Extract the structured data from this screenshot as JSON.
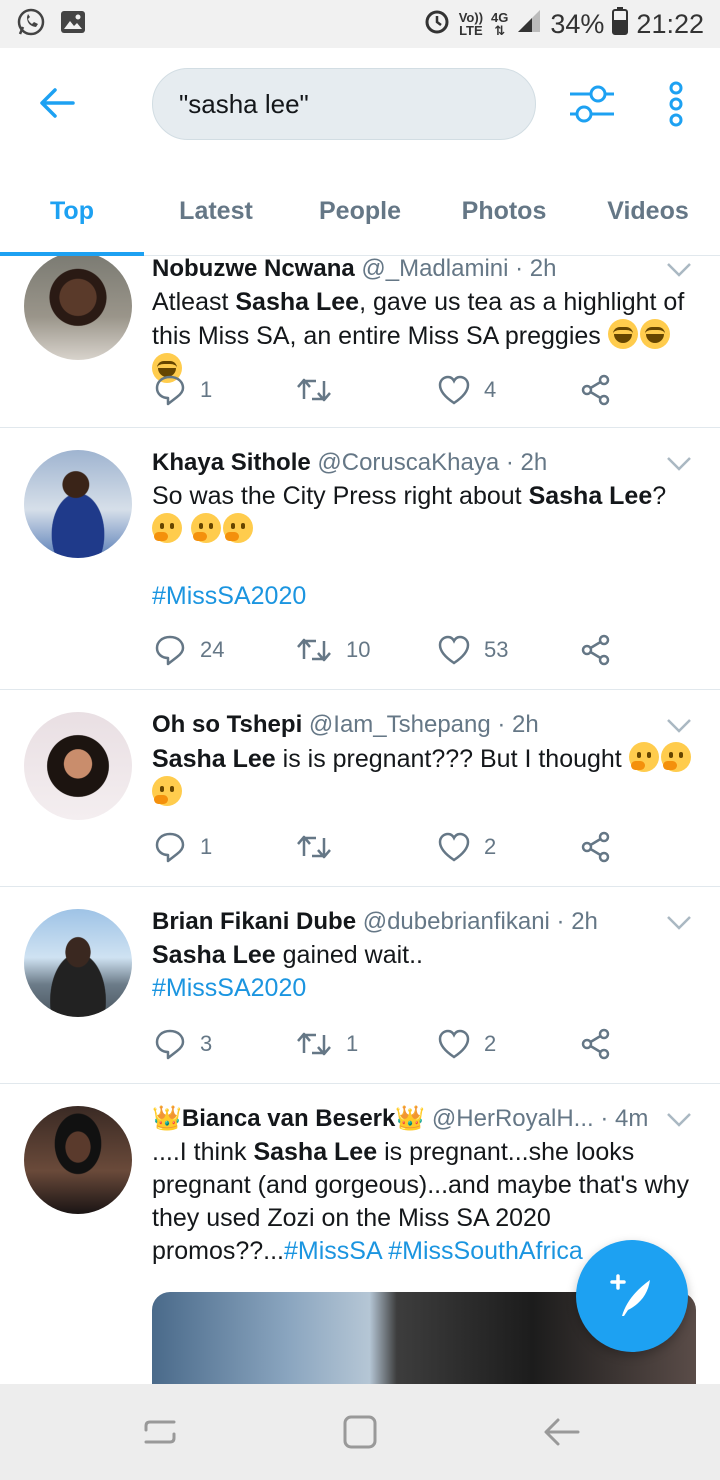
{
  "status_bar": {
    "network_top": "Vo))",
    "network_bottom": "LTE",
    "data_top": "4G",
    "data_bottom": "⇅",
    "battery": "34%",
    "time": "21:22"
  },
  "search": {
    "query": "\"sasha lee\""
  },
  "tabs": [
    {
      "label": "Top",
      "active": true
    },
    {
      "label": "Latest",
      "active": false
    },
    {
      "label": "People",
      "active": false
    },
    {
      "label": "Photos",
      "active": false
    },
    {
      "label": "Videos",
      "active": false
    }
  ],
  "tweets": [
    {
      "name": "Nobuzwe Ncwana",
      "handle": "@_Madlamini",
      "time": "· 2h",
      "text_pre": "Atleast ",
      "text_bold": "Sasha Lee",
      "text_post": ", gave us tea as a highlight of this Miss SA, an entire Miss SA preggies ",
      "replies": "1",
      "retweets": "",
      "likes": "4"
    },
    {
      "name": "Khaya Sithole",
      "handle": "@CoruscaKhaya",
      "time": "· 2h",
      "text_pre": "So was the City Press right about ",
      "text_bold": "Sasha Lee",
      "text_post": "? ",
      "hashtag": "#MissSA2020",
      "replies": "24",
      "retweets": "10",
      "likes": "53"
    },
    {
      "name": "Oh so Tshepi",
      "handle": "@Iam_Tshepang",
      "time": "· 2h",
      "text_bold": "Sasha Lee",
      "text_post": " is is pregnant??? But I thought ",
      "replies": "1",
      "retweets": "",
      "likes": "2"
    },
    {
      "name": "Brian Fikani Dube",
      "handle": "@dubebrianfikani",
      "time": "· 2h",
      "text_bold": "Sasha Lee",
      "text_post": " gained wait..",
      "hashtag": "#MissSA2020",
      "replies": "3",
      "retweets": "1",
      "likes": "2"
    },
    {
      "name": "Bianca van Beserk",
      "crown": "👑",
      "handle": "@HerRoyalH...",
      "time": "· 4m",
      "text_pre": "....I think ",
      "text_bold": "Sasha Lee",
      "text_post": " is pregnant...she looks pregnant (and gorgeous)...and maybe that's why they used Zozi on the Miss SA 2020 promos??...",
      "hashtag": "#MissSA",
      "hashtag2": "#MissSouthAfrica"
    }
  ],
  "colors": {
    "accent": "#1da1f2",
    "link": "#1b95e0",
    "muted": "#657786",
    "text": "#14171a"
  },
  "icons": [
    "whatsapp-icon",
    "gallery-icon",
    "alarm-icon",
    "signal-icon",
    "battery-icon",
    "back-arrow-icon",
    "filter-icon",
    "more-vertical-icon",
    "reply-icon",
    "retweet-icon",
    "like-icon",
    "share-icon",
    "compose-icon",
    "recents-icon",
    "home-icon",
    "back-icon"
  ]
}
